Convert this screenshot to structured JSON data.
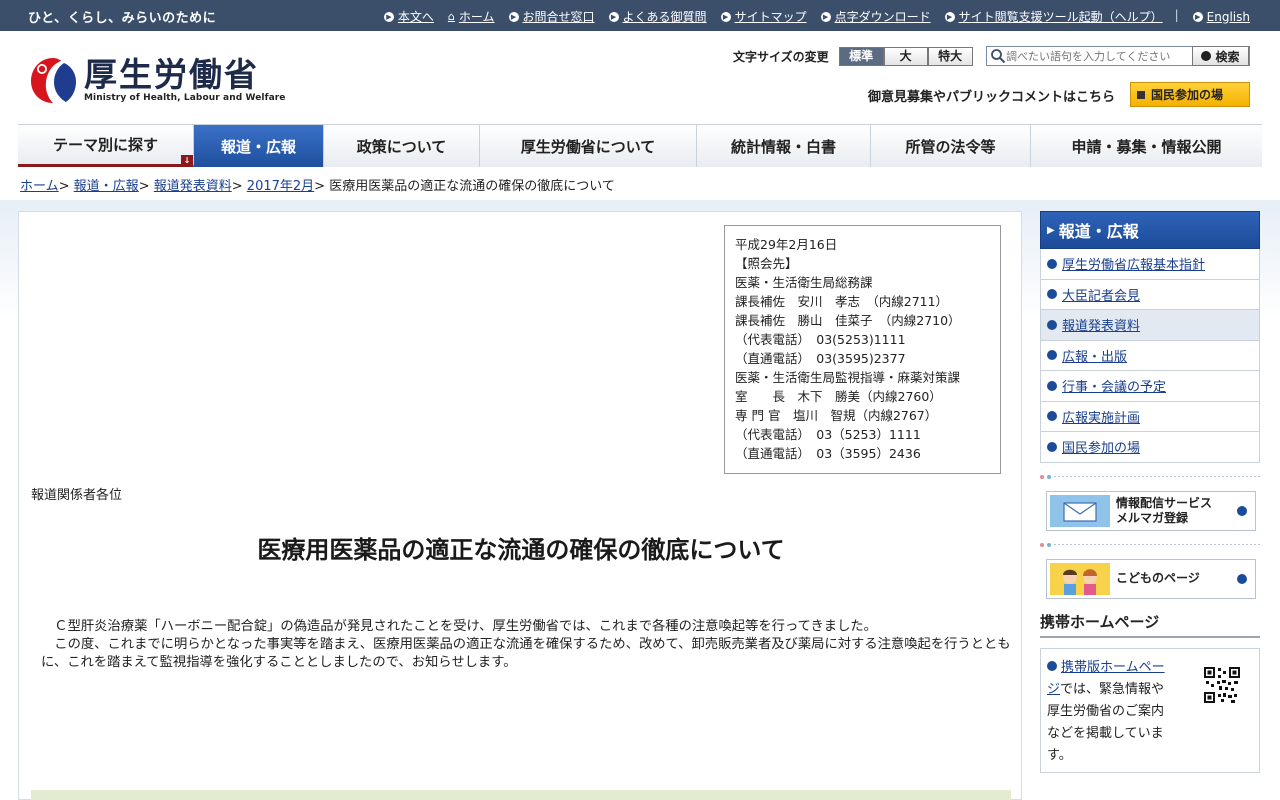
{
  "topbar": {
    "tagline": "ひと、くらし、みらいのために",
    "links": [
      {
        "label": "本文へ"
      },
      {
        "label": "ホーム"
      },
      {
        "label": "お問合せ窓口"
      },
      {
        "label": "よくある御質問"
      },
      {
        "label": "サイトマップ"
      },
      {
        "label": "点字ダウンロード"
      },
      {
        "label": "サイト閲覧支援ツール起動（ヘルプ）"
      },
      {
        "label": "English"
      }
    ],
    "separator": "|"
  },
  "header": {
    "logo_jp": "厚生労働省",
    "logo_en": "Ministry of Health, Labour and Welfare",
    "fontsize_label": "文字サイズの変更",
    "fontsize_options": [
      "標準",
      "大",
      "特大"
    ],
    "search_placeholder": "調べたい語句を入力してください",
    "search_button": "検索",
    "public_comment": "御意見募集やパブリックコメントはこちら",
    "kokumin_button": "国民参加の場"
  },
  "nav": [
    {
      "label": "テーマ別に探す"
    },
    {
      "label": "報道・広報"
    },
    {
      "label": "政策について"
    },
    {
      "label": "厚生労働省について"
    },
    {
      "label": "統計情報・白書"
    },
    {
      "label": "所管の法令等"
    },
    {
      "label": "申請・募集・情報公開"
    }
  ],
  "breadcrumb": {
    "items": [
      "ホーム",
      "報道・広報",
      "報道発表資料",
      "2017年2月"
    ],
    "separator": ">",
    "current": "医療用医薬品の適正な流通の確保の徹底について"
  },
  "contact": {
    "lines": [
      "平成29年2月16日",
      "【照会先】",
      "医薬・生活衛生局総務課",
      "課長補佐　安川　孝志　（内線2711）",
      "課長補佐　勝山　佳菜子　（内線2710）",
      "（代表電話）　03(5253)1111",
      "（直通電話）　03(3595)2377",
      "医薬・生活衛生局監視指導・麻薬対策課",
      "室　　長　木下　勝美（内線2760）",
      "専 門 官　塩川　智規（内線2767）",
      "（代表電話）　03（5253）1111",
      "（直通電話）　03（3595）2436"
    ]
  },
  "article": {
    "addressee": "報道関係者各位",
    "title": "医療用医薬品の適正な流通の確保の徹底について",
    "paragraphs": [
      "　Ｃ型肝炎治療薬「ハーボニー配合錠」の偽造品が発見されたことを受け、厚生労働省では、これまで各種の注意喚起等を行ってきました。",
      "　この度、これまでに明らかとなった事実等を踏まえ、医療用医薬品の適正な流通を確保するため、改めて、卸売販売業者及び薬局に対する注意喚起を行うとともに、これを踏まえて監視指導を強化することとしましたので、お知らせします。"
    ]
  },
  "sidebar": {
    "heading": "報道・広報",
    "items": [
      {
        "label": "厚生労働省広報基本指針"
      },
      {
        "label": "大臣記者会見"
      },
      {
        "label": "報道発表資料"
      },
      {
        "label": "広報・出版"
      },
      {
        "label": "行事・会議の予定"
      },
      {
        "label": "広報実施計画"
      },
      {
        "label": "国民参加の場"
      }
    ],
    "mail_banner": {
      "line1": "情報配信サービス",
      "line2": "メルマガ登録"
    },
    "kids_banner": {
      "label": "こどものページ"
    },
    "mobile_heading": "携帯ホームページ",
    "mobile_link": "携帯版ホームページ",
    "mobile_text": "では、緊急情報や厚生労働省のご案内などを掲載しています。"
  },
  "colors": {
    "topbar": "#3b4f6b",
    "nav_active": "#2a5fb3",
    "kokumin": "#f5b100",
    "footer_band": "#e3ebd1"
  }
}
